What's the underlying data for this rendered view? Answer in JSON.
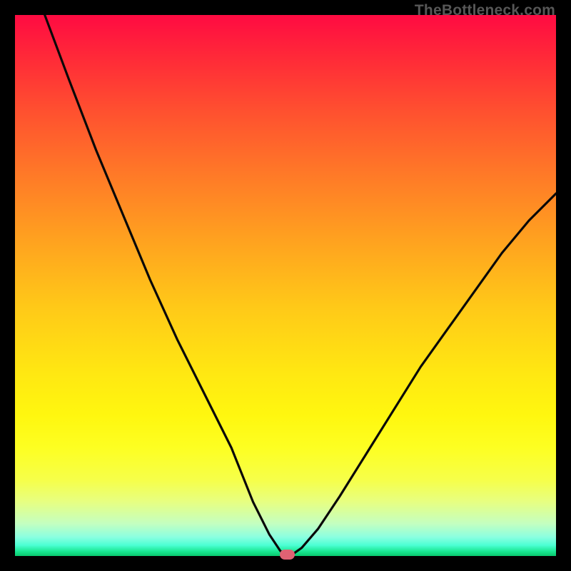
{
  "watermark": "TheBottleneck.com",
  "chart_data": {
    "type": "line",
    "title": "",
    "xlabel": "",
    "ylabel": "",
    "xlim": [
      0,
      100
    ],
    "ylim": [
      0,
      100
    ],
    "x": [
      5.5,
      10,
      15,
      20,
      25,
      30,
      35,
      40,
      44,
      47,
      49,
      50,
      51,
      53,
      56,
      60,
      65,
      70,
      75,
      80,
      85,
      90,
      95,
      100
    ],
    "values": [
      100,
      88,
      75,
      63,
      51,
      40,
      30,
      20,
      10,
      4,
      1,
      0.1,
      0.1,
      1.5,
      5,
      11,
      19,
      27,
      35,
      42,
      49,
      56,
      62,
      67
    ],
    "min_marker": {
      "x": 50.2,
      "y": 0.1
    }
  },
  "colors": {
    "background": "#000000",
    "gradient_top": "#ff0b42",
    "gradient_bottom": "#09c86e",
    "curve": "#080808",
    "marker": "#e06273"
  }
}
